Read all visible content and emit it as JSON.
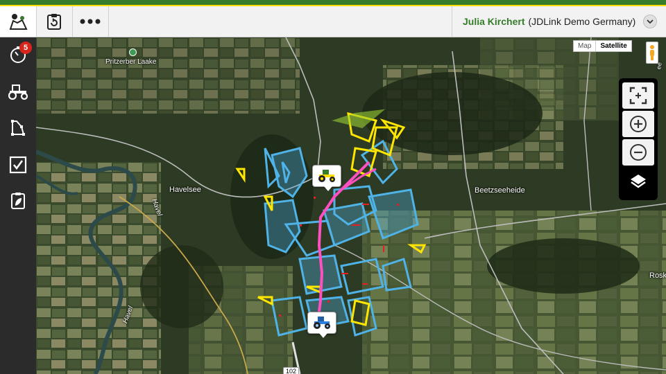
{
  "topbar": {
    "buttons": [
      {
        "icon": "map-machines-icon"
      },
      {
        "icon": "clipboard-icon"
      },
      {
        "icon": "more-dots-icon"
      }
    ],
    "user_name": "Julia Kirchert",
    "user_org": "(JDLink Demo Germany)",
    "dropdown_icon": "chevron-down-icon"
  },
  "sidebar": {
    "items": [
      {
        "icon": "timer-icon",
        "badge": "5"
      },
      {
        "icon": "tractor-icon"
      },
      {
        "icon": "field-boundary-icon"
      },
      {
        "icon": "checkbox-icon"
      },
      {
        "icon": "document-leaf-icon"
      }
    ]
  },
  "map": {
    "type_options": [
      "Map",
      "Satellite"
    ],
    "selected_type": "Satellite",
    "labels": {
      "pritzerber": "Pritzerber Laake",
      "havelsee": "Havelsee",
      "havel1": "Havel",
      "havel2": "Havel",
      "beetzseeheide": "Beetzseeheide",
      "rosk": "Rosk",
      "road": "102",
      "see": "ee"
    },
    "controls": [
      {
        "icon": "fullscreen-icon"
      },
      {
        "icon": "zoom-in-icon"
      },
      {
        "icon": "zoom-out-icon"
      },
      {
        "icon": "layers-icon"
      }
    ],
    "markers": [
      {
        "icon": "tractor-yellow-icon"
      },
      {
        "icon": "tractor-blue-icon"
      }
    ]
  },
  "colors": {
    "brand_green": "#367c2b",
    "brand_yellow": "#ffde00",
    "field_blue": "#4fb3e8",
    "field_yellow": "#ffe600",
    "track_pink": "#ff4fc1"
  }
}
